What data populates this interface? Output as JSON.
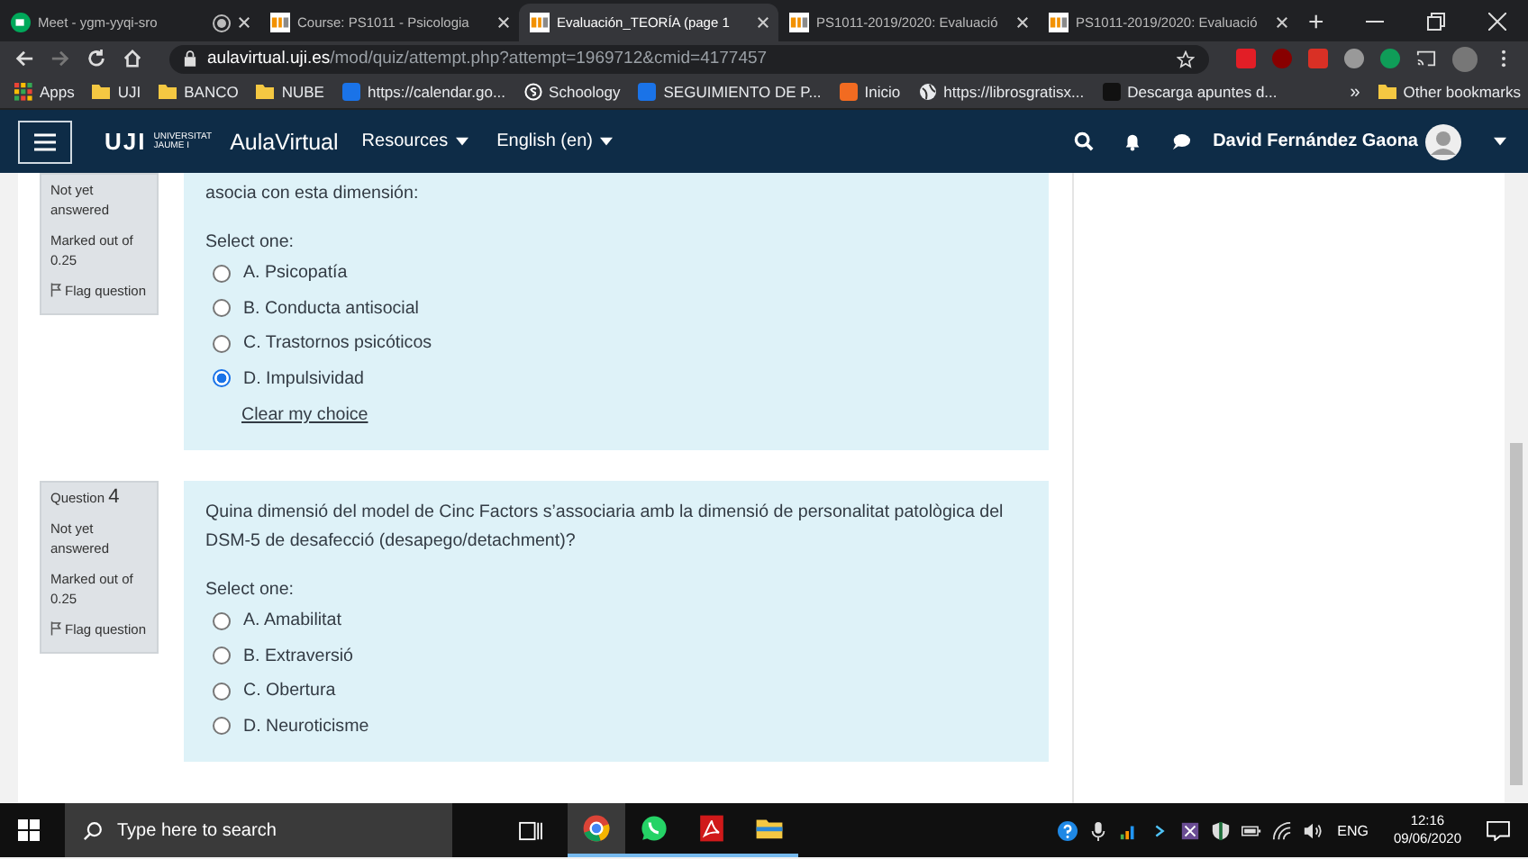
{
  "browser": {
    "tabs": [
      {
        "title": "Meet - ygm-yyqi-sro",
        "selected": false,
        "kind": "meet",
        "recording": true
      },
      {
        "title": "Course: PS1011 - Psicologia",
        "selected": false,
        "kind": "uji",
        "recording": false
      },
      {
        "title": "Evaluación_TEORÍA (page 1",
        "selected": true,
        "kind": "uji",
        "recording": false
      },
      {
        "title": "PS1011-2019/2020: Evaluació",
        "selected": false,
        "kind": "uji",
        "recording": false
      },
      {
        "title": "PS1011-2019/2020: Evaluació",
        "selected": false,
        "kind": "uji",
        "recording": false
      }
    ],
    "new_tab": "+",
    "address": {
      "domain": "aulavirtual.uji.es",
      "path": "/mod/quiz/attempt.php?attempt=1969712&cmid=4177457"
    },
    "bookmarks": [
      {
        "label": "Apps",
        "kind": "apps"
      },
      {
        "label": "UJI",
        "kind": "folder"
      },
      {
        "label": "BANCO",
        "kind": "folder"
      },
      {
        "label": "NUBE",
        "kind": "folder"
      },
      {
        "label": "https://calendar.go...",
        "kind": "calendar"
      },
      {
        "label": "Schoology",
        "kind": "schoology"
      },
      {
        "label": "SEGUIMIENTO DE P...",
        "kind": "calendar"
      },
      {
        "label": "Inicio",
        "kind": "orange"
      },
      {
        "label": "https://librosgratisx...",
        "kind": "globe"
      },
      {
        "label": "Descarga apuntes d...",
        "kind": "dark"
      }
    ],
    "more": "»",
    "other_bookmarks": "Other bookmarks"
  },
  "navbar": {
    "logo_mark": "UJI",
    "logo_text": [
      "UNIVERSITAT",
      "JAUME I"
    ],
    "site": "AulaVirtual",
    "menus": [
      "Resources",
      "English (en)"
    ],
    "user": "David Fernández Gaona"
  },
  "questions": [
    {
      "status": "Not yet answered",
      "marks": "Marked out of 0.25",
      "flag": "Flag question",
      "text": "asocia con esta dimensión:",
      "prompt": "Select one:",
      "options": [
        {
          "label": "A. Psicopatía",
          "selected": false
        },
        {
          "label": "B. Conducta antisocial",
          "selected": false
        },
        {
          "label": "C. Trastornos psicóticos",
          "selected": false
        },
        {
          "label": "D. Impulsividad",
          "selected": true
        }
      ],
      "clear": "Clear my choice"
    },
    {
      "label": "Question",
      "number": "4",
      "status": "Not yet answered",
      "marks": "Marked out of 0.25",
      "flag": "Flag question",
      "text": "Quina dimensió del model de Cinc Factors s’associaria amb la dimensió de personalitat patològica del DSM-5 de desafecció (desapego/detachment)?",
      "prompt": "Select one:",
      "options": [
        {
          "label": "A. Amabilitat",
          "selected": false
        },
        {
          "label": "B. Extraversió",
          "selected": false
        },
        {
          "label": "C. Obertura",
          "selected": false
        },
        {
          "label": "D. Neuroticisme",
          "selected": false
        }
      ]
    }
  ],
  "taskbar": {
    "search_placeholder": "Type here to search",
    "apps": [
      {
        "kind": "chrome",
        "selected": true
      },
      {
        "kind": "whatsapp",
        "selected": false
      },
      {
        "kind": "acrobat",
        "selected": false
      },
      {
        "kind": "folder",
        "selected": false
      }
    ],
    "language": "ENG",
    "time": "12:16",
    "date": "09/06/2020"
  }
}
